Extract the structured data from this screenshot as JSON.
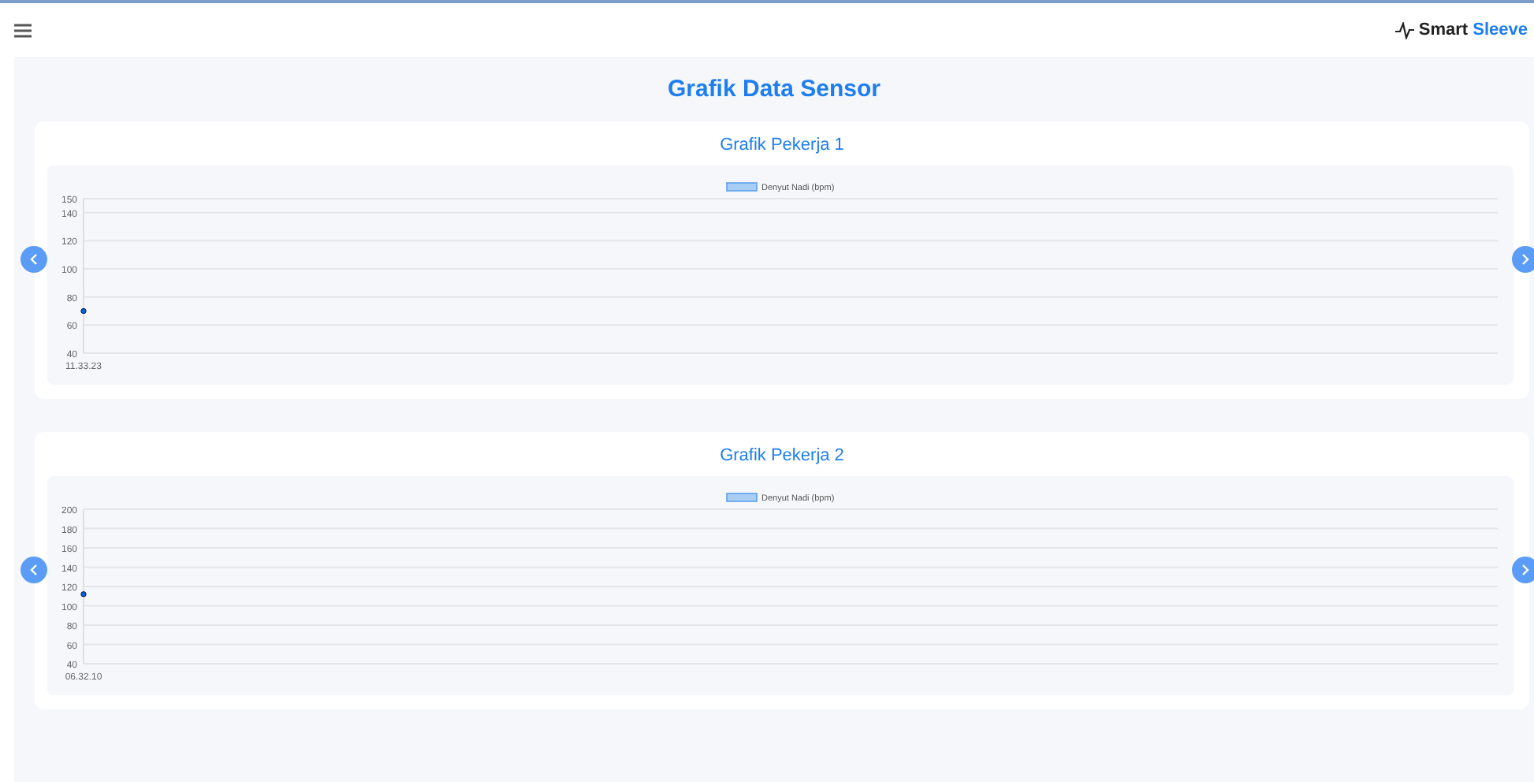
{
  "header": {
    "brand_first": "Smart",
    "brand_second": "Sleeve"
  },
  "page_title": "Grafik Data Sensor",
  "cards": [
    {
      "title": "Grafik Pekerja 1",
      "chart_data": {
        "type": "line",
        "categories": [
          "11.33.23"
        ],
        "series": [
          {
            "name": "Denyut Nadi (bpm)",
            "color": "#0b5ed7",
            "marker": true,
            "values": [
              70
            ]
          }
        ],
        "grid": true,
        "ylim": [
          40,
          150
        ],
        "yticks": [
          40,
          60,
          80,
          100,
          120,
          140,
          150
        ]
      }
    },
    {
      "title": "Grafik Pekerja 2",
      "chart_data": {
        "type": "line",
        "categories": [
          "06.32.10"
        ],
        "series": [
          {
            "name": "Denyut Nadi (bpm)",
            "color": "#0b5ed7",
            "marker": true,
            "values": [
              112
            ]
          }
        ],
        "grid": true,
        "ylim": [
          40,
          200
        ],
        "yticks": [
          40,
          60,
          80,
          100,
          120,
          140,
          160,
          180,
          200
        ]
      }
    }
  ]
}
